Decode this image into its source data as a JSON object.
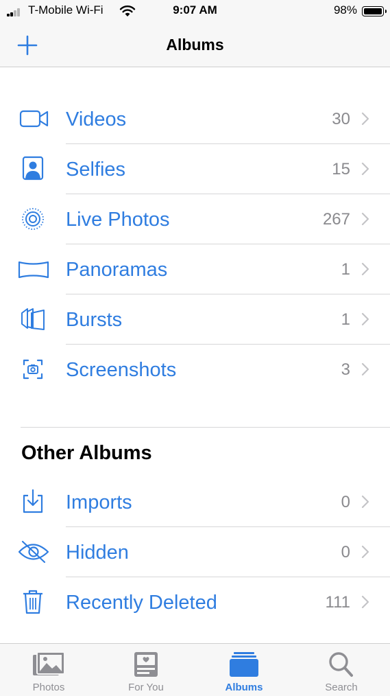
{
  "status_bar": {
    "carrier": "T-Mobile Wi-Fi",
    "time": "9:07 AM",
    "battery": "98%"
  },
  "nav": {
    "title": "Albums",
    "add_icon": "plus-icon"
  },
  "media_types": [
    {
      "label": "Videos",
      "count": "30",
      "icon": "video-camera-icon"
    },
    {
      "label": "Selfies",
      "count": "15",
      "icon": "portrait-icon"
    },
    {
      "label": "Live Photos",
      "count": "267",
      "icon": "live-photo-icon"
    },
    {
      "label": "Panoramas",
      "count": "1",
      "icon": "panorama-icon"
    },
    {
      "label": "Bursts",
      "count": "1",
      "icon": "bursts-icon"
    },
    {
      "label": "Screenshots",
      "count": "3",
      "icon": "screenshot-icon"
    }
  ],
  "other_albums": {
    "title": "Other Albums",
    "items": [
      {
        "label": "Imports",
        "count": "0",
        "icon": "import-icon"
      },
      {
        "label": "Hidden",
        "count": "0",
        "icon": "eye-slash-icon"
      },
      {
        "label": "Recently Deleted",
        "count": "111",
        "icon": "trash-icon"
      }
    ]
  },
  "tab_bar": {
    "tabs": [
      {
        "label": "Photos",
        "icon": "photos-icon",
        "active": false
      },
      {
        "label": "For You",
        "icon": "for-you-icon",
        "active": false
      },
      {
        "label": "Albums",
        "icon": "albums-icon",
        "active": true
      },
      {
        "label": "Search",
        "icon": "search-icon",
        "active": false
      }
    ]
  },
  "colors": {
    "accent": "#2f7de0",
    "secondary_text": "#8a8a8e",
    "bar_background": "#f7f7f7",
    "separator": "#d6d6d8"
  }
}
